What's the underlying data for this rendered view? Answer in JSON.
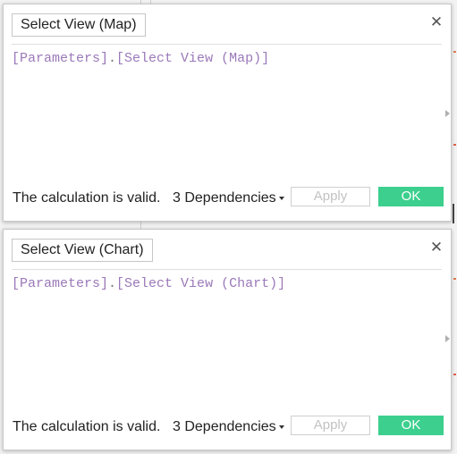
{
  "colors": {
    "page_background": "#f2f2f2",
    "dialog_background": "#ffffff",
    "code_text": "#9b79b9",
    "ok_button": "#3ccf8e",
    "apply_button_text": "#c2c2c2",
    "background_marks": [
      "#e07a4e",
      "#e05f4a"
    ]
  },
  "dialogs": [
    {
      "name_value": "Select View (Map)",
      "close_icon": "close-icon",
      "formula": {
        "table_ref": "[Parameters]",
        "separator": ".",
        "field_ref": "[Select View (Map)]"
      },
      "status_text": "The calculation is valid.",
      "dependencies_label": "3 Dependencies",
      "apply_label": "Apply",
      "ok_label": "OK"
    },
    {
      "name_value": "Select View (Chart)",
      "close_icon": "close-icon",
      "formula": {
        "table_ref": "[Parameters]",
        "separator": ".",
        "field_ref": "[Select View (Chart)]"
      },
      "status_text": "The calculation is valid.",
      "dependencies_label": "3 Dependencies",
      "apply_label": "Apply",
      "ok_label": "OK"
    }
  ]
}
